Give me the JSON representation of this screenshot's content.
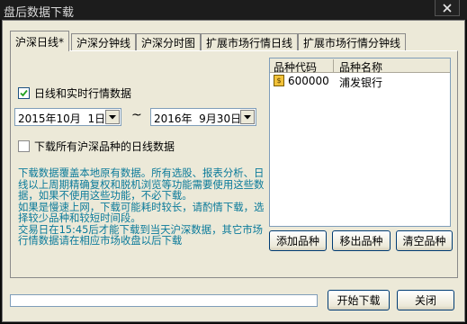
{
  "window": {
    "title": "盘后数据下载"
  },
  "tabs": [
    {
      "label": "沪深日线*"
    },
    {
      "label": "沪深分钟线"
    },
    {
      "label": "沪深分时图"
    },
    {
      "label": "扩展市场行情日线"
    },
    {
      "label": "扩展市场行情分钟线"
    }
  ],
  "options": {
    "daily_realtime_label": "日线和实时行情数据",
    "daily_realtime_checked": true,
    "start_date": "2015年10月  1日",
    "range_sep": "~",
    "end_date": "2016年  9月30日",
    "all_products_label": "下载所有沪深品种的日线数据",
    "all_products_checked": false
  },
  "notes": {
    "line1": "    下载数据覆盖本地原有数据。所有选股、报表分析、日线以上周期精确复权和脱机浏览等功能需要使用这些数据，如果不使用这些功能，不必下载。",
    "line2": "    如果是慢速上网，下载可能耗时较长，请酌情下载，选择较少品种和较短时间段。",
    "line3": "    交易日在15:45后才能下载到当天沪深数据，其它市场行情数据请在相应市场收盘以后下载"
  },
  "product_list": {
    "columns": [
      "品种代码",
      "品种名称"
    ],
    "rows": [
      {
        "code": "600000",
        "name": "浦发银行",
        "icon": "stock-icon",
        "icon_glyph": "$"
      }
    ]
  },
  "list_buttons": {
    "add": "添加品种",
    "remove": "移出品种",
    "clear": "清空品种"
  },
  "progress": {
    "value": 0
  },
  "footer": {
    "start": "开始下载",
    "close": "关闭"
  }
}
